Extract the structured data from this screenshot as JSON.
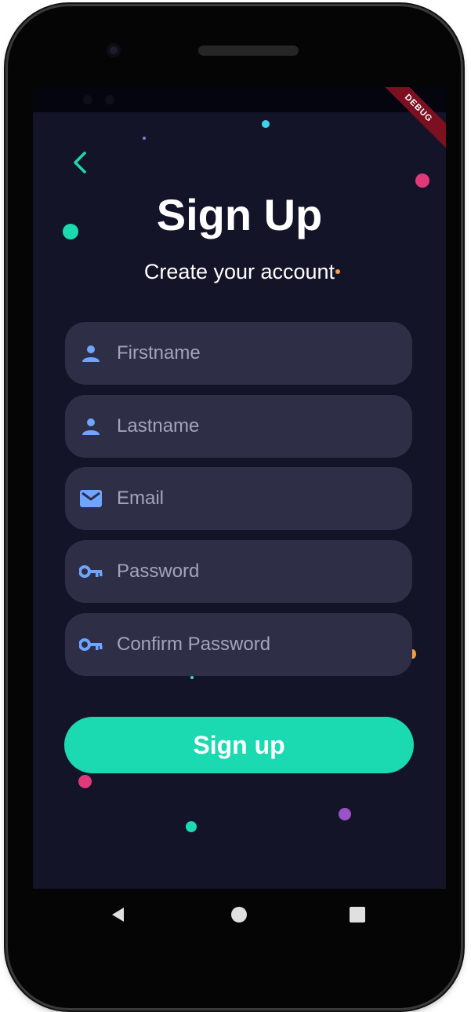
{
  "app": {
    "debug_label": "DEBUG"
  },
  "header": {
    "title": "Sign Up",
    "subtitle": "Create your account"
  },
  "form": {
    "fields": [
      {
        "placeholder": "Firstname",
        "icon": "person-icon",
        "type": "text"
      },
      {
        "placeholder": "Lastname",
        "icon": "person-icon",
        "type": "text"
      },
      {
        "placeholder": "Email",
        "icon": "mail-icon",
        "type": "email"
      },
      {
        "placeholder": "Password",
        "icon": "key-icon",
        "type": "password"
      },
      {
        "placeholder": "Confirm Password",
        "icon": "key-icon",
        "type": "password"
      }
    ],
    "submit_label": "Sign up"
  },
  "colors": {
    "background": "#141428",
    "field_bg": "#2e2f47",
    "accent": "#1bd9b0",
    "icon": "#6ea6ff",
    "placeholder": "#a2a4ba",
    "back_arrow": "#1bd9b0"
  },
  "icons": {
    "back": "chevron-left-icon",
    "nav_back": "triangle-back-icon",
    "nav_home": "circle-home-icon",
    "nav_recents": "square-recents-icon"
  }
}
